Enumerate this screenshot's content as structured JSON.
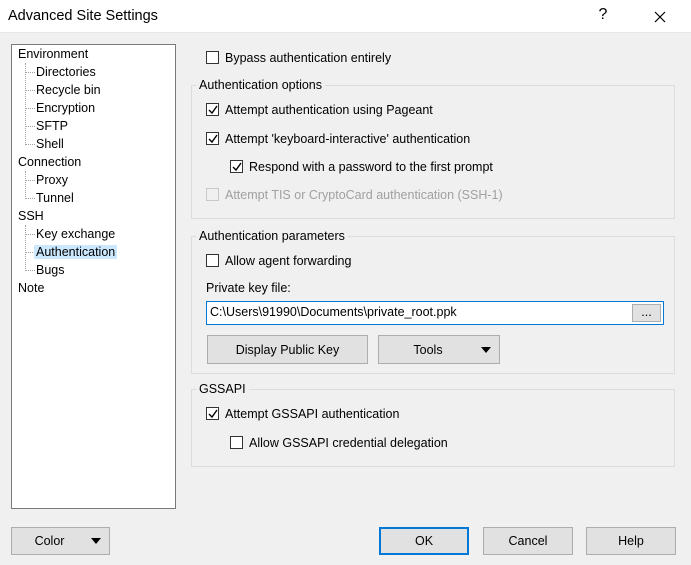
{
  "window": {
    "title": "Advanced Site Settings",
    "help_label": "?"
  },
  "tree": {
    "items": [
      {
        "label": "Environment"
      },
      {
        "label": "Directories"
      },
      {
        "label": "Recycle bin"
      },
      {
        "label": "Encryption"
      },
      {
        "label": "SFTP"
      },
      {
        "label": "Shell"
      },
      {
        "label": "Connection"
      },
      {
        "label": "Proxy"
      },
      {
        "label": "Tunnel"
      },
      {
        "label": "SSH"
      },
      {
        "label": "Key exchange"
      },
      {
        "label": "Authentication",
        "selected": true
      },
      {
        "label": "Bugs"
      },
      {
        "label": "Note"
      }
    ]
  },
  "bypass": {
    "label": "Bypass authentication entirely",
    "checked": false
  },
  "auth_options": {
    "title": "Authentication options",
    "pageant": {
      "label": "Attempt authentication using Pageant",
      "checked": true
    },
    "keyboard_interactive": {
      "label": "Attempt 'keyboard-interactive' authentication",
      "checked": true
    },
    "respond_password": {
      "label": "Respond with a password to the first prompt",
      "checked": true
    },
    "tis_cryptocard": {
      "label": "Attempt TIS or CryptoCard authentication (SSH-1)",
      "checked": false,
      "disabled": true
    }
  },
  "auth_params": {
    "title": "Authentication parameters",
    "agent_forwarding": {
      "label": "Allow agent forwarding",
      "checked": false
    },
    "private_key_label": "Private key file:",
    "private_key_value": "C:\\Users\\91990\\Documents\\private_root.ppk",
    "browse_label": "...",
    "display_public_key_label": "Display Public Key",
    "tools_label": "Tools"
  },
  "gssapi": {
    "title": "GSSAPI",
    "attempt": {
      "label": "Attempt GSSAPI authentication",
      "checked": true
    },
    "delegation": {
      "label": "Allow GSSAPI credential delegation",
      "checked": false
    }
  },
  "footer": {
    "color_label": "Color",
    "ok_label": "OK",
    "cancel_label": "Cancel",
    "help_label": "Help"
  },
  "colors": {
    "selection": "#cce8ff",
    "focus_border": "#0078d7",
    "dialog_bg": "#f0f0f0"
  },
  "icons": {
    "close": "close-icon",
    "checkmark": "checkmark-icon",
    "dropdown": "chevron-down-icon"
  }
}
